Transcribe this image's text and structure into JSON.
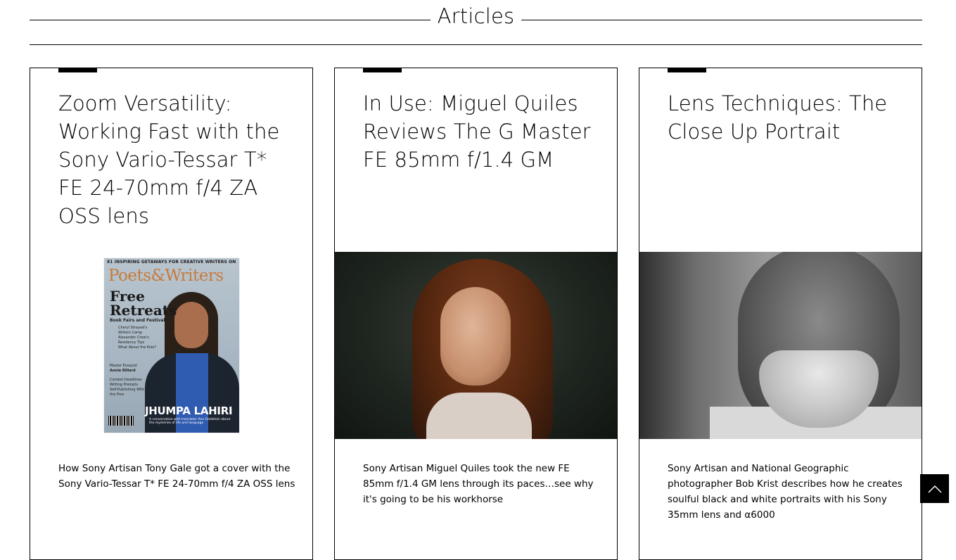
{
  "header": {
    "title": "Articles"
  },
  "cards": [
    {
      "title": "Zoom Versatility: Working Fast with the Sony Vario-Tessar T* FE 24-70mm f/4 ZA OSS lens",
      "description": "How Sony Artisan Tony Gale got a cover with the Sony Vario-Tessar T* FE 24-70mm f/4 ZA OSS lens",
      "image": {
        "type": "magazine-cover",
        "top_line": "81 INSPIRING GETAWAYS FOR CREATIVE WRITERS ON A BUDGET",
        "logo": "Poets&Writers",
        "headline_1": "Free",
        "headline_2": "Retreats",
        "subhead": "Book Fairs and Festivals",
        "list": [
          "Cheryl Strayed's Writers Camp",
          "Alexander Chee's Residency Tips",
          "What About the Kids?"
        ],
        "side": [
          "Master Essayist",
          "Annie Dillard",
          "Contest Deadlines Writing Prompts",
          "Self-Publishing With the Pros"
        ],
        "cover_name": "JHUMPA LAHIRI",
        "cover_name_sub": "A conversation with translator Ann Goldstein about the mysteries of life and language"
      }
    },
    {
      "title": "In Use: Miguel Quiles Reviews The G Master FE 85mm f/1.4 GM",
      "description": "Sony Artisan Miguel Quiles took the new FE 85mm f/1.4 GM lens through its paces…see why it's going to be his workhorse",
      "image": {
        "type": "portrait-woman"
      }
    },
    {
      "title": "Lens Techniques: The Close Up Portrait",
      "description": "Sony Artisan and National Geographic photographer Bob Krist describes how he creates soulful black and white portraits with his Sony 35mm lens and α6000",
      "image": {
        "type": "portrait-man-bw"
      }
    }
  ],
  "scroll_top": {
    "icon": "chevron-up-icon"
  },
  "colors": {
    "text": "#000000",
    "background": "#ffffff",
    "border": "#000000"
  }
}
